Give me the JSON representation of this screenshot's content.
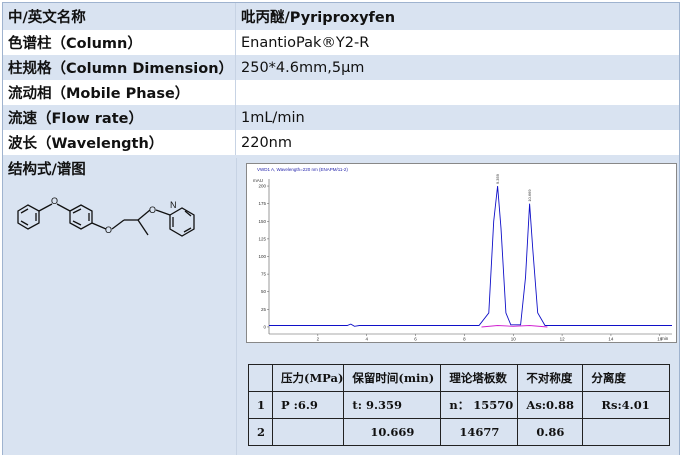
{
  "rows": [
    {
      "label": "中/英文名称",
      "value": "吡丙醚/Pyriproxyfen"
    },
    {
      "label": "色谱柱（Column）",
      "value": "EnantioPak®Y2-R"
    },
    {
      "label": "柱规格（Column Dimension）",
      "value": "250*4.6mm,5μm"
    },
    {
      "label": "流动相（Mobile Phase）",
      "value": ""
    },
    {
      "label": "流速（Flow rate）",
      "value": "1mL/min"
    },
    {
      "label": "波长（Wavelength）",
      "value": "220nm"
    },
    {
      "label": "结构式/谱图",
      "value": ""
    }
  ],
  "chromatogram": {
    "header": "VWD1 A, Wavelength=220 nm (ENAPM/11-2)",
    "y_unit": "mAU",
    "x_unit": "min",
    "y_ticks": [
      "200",
      "175",
      "150",
      "125",
      "100",
      "75",
      "50",
      "25",
      "0"
    ],
    "x_ticks": [
      "2",
      "4",
      "6",
      "8",
      "10",
      "12",
      "14",
      "16"
    ],
    "peak_labels": [
      "9.359",
      "10.669"
    ]
  },
  "chart_data": {
    "type": "line",
    "title": "VWD1 A, Wavelength=220 nm (ENAPM/11-2)",
    "xlabel": "min",
    "ylabel": "mAU",
    "xlim": [
      0,
      16.5
    ],
    "ylim": [
      -10,
      210
    ],
    "series": [
      {
        "values": [
          [
            0,
            2
          ],
          [
            3.2,
            2
          ],
          [
            3.35,
            4
          ],
          [
            3.5,
            1
          ],
          [
            3.7,
            2
          ],
          [
            8.6,
            2
          ],
          [
            9.0,
            20
          ],
          [
            9.2,
            150
          ],
          [
            9.359,
            200
          ],
          [
            9.5,
            140
          ],
          [
            9.7,
            20
          ],
          [
            9.9,
            3
          ],
          [
            10.3,
            3
          ],
          [
            10.5,
            70
          ],
          [
            10.669,
            175
          ],
          [
            10.8,
            110
          ],
          [
            11.0,
            20
          ],
          [
            11.3,
            2
          ],
          [
            16.5,
            2
          ]
        ]
      },
      {
        "values": [
          [
            8.7,
            0
          ],
          [
            9.359,
            2
          ],
          [
            10.0,
            1
          ],
          [
            10.669,
            2
          ],
          [
            11.4,
            0
          ]
        ]
      }
    ]
  },
  "results": {
    "headers": [
      "",
      "压力(MPa)",
      "保留时间(min)",
      "理论塔板数",
      "不对称度",
      "分离度"
    ],
    "rows": [
      [
        "1",
        "P :6.9",
        "t: 9.359",
        "n： 15570",
        "As:0.88",
        "Rs:4.01"
      ],
      [
        "2",
        "",
        "10.669",
        "14677",
        "0.86",
        ""
      ]
    ]
  },
  "colors": {
    "row_alt": "#d9e3f1",
    "trace1": "#1010c8",
    "trace2": "#d020d0"
  }
}
